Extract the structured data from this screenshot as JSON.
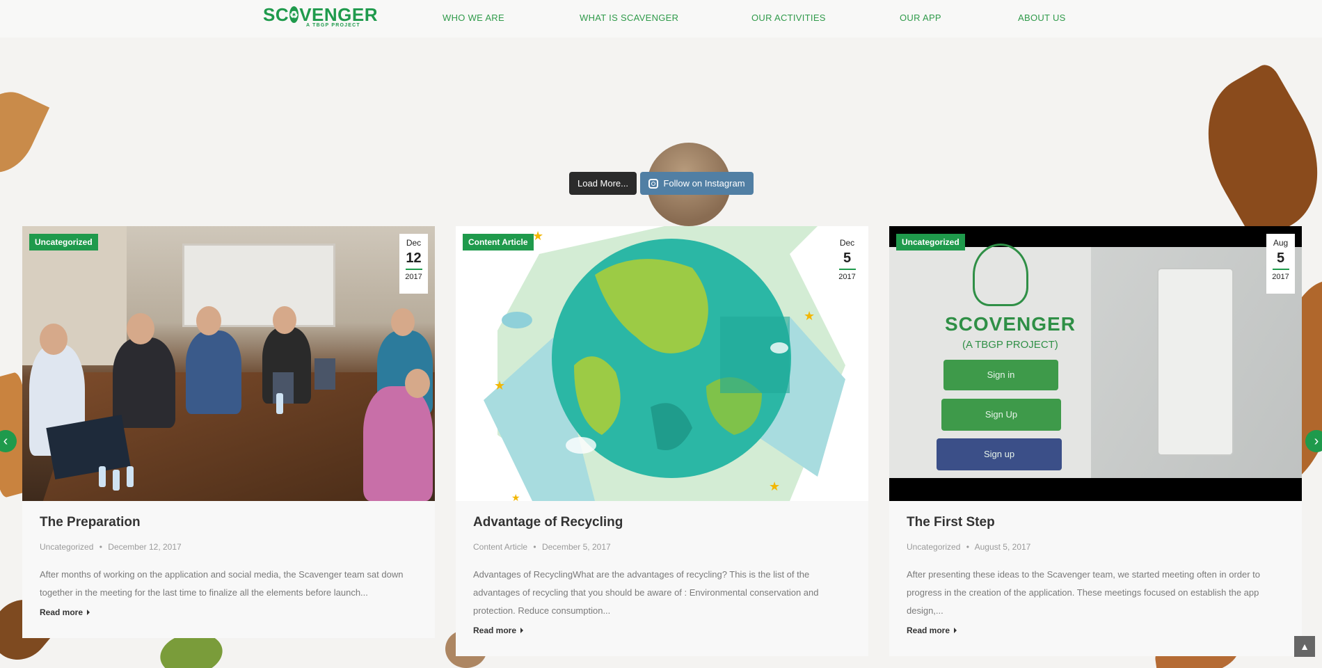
{
  "logo": {
    "main_left": "SC",
    "main_right": "VENGER",
    "sub": "A TBGP PROJECT",
    "icon": "recycle-icon"
  },
  "nav": [
    "WHO WE ARE",
    "WHAT IS SCAVENGER",
    "OUR ACTIVITIES",
    "OUR APP",
    "ABOUT US"
  ],
  "instagram": {
    "load_more": "Load More...",
    "follow": "Follow on Instagram",
    "icon": "instagram-icon"
  },
  "posts": [
    {
      "category_badge": "Uncategorized",
      "date": {
        "month": "Dec",
        "day": "12",
        "year": "2017"
      },
      "title": "The Preparation",
      "meta_category": "Uncategorized",
      "meta_date": "December 12, 2017",
      "excerpt": "After months of working on the application and social media, the Scavenger team sat down together in the meeting for the last time to finalize all the elements before launch...",
      "read_more": "Read more"
    },
    {
      "category_badge": "Content Article",
      "date": {
        "month": "Dec",
        "day": "5",
        "year": "2017"
      },
      "title": "Advantage of Recycling",
      "meta_category": "Content Article",
      "meta_date": "December 5, 2017",
      "excerpt": "Advantages of RecyclingWhat are the advantages of recycling? This is the list of the advantages of recycling that you should be aware of : Environmental conservation and protection. Reduce consumption...",
      "read_more": "Read more"
    },
    {
      "category_badge": "Uncategorized",
      "date": {
        "month": "Aug",
        "day": "5",
        "year": "2017"
      },
      "title": "The First Step",
      "meta_category": "Uncategorized",
      "meta_date": "August 5, 2017",
      "excerpt": "After presenting these ideas to the Scavenger team, we started meeting often in order to progress in the creation of the application. These meetings focused on establish the app design,...",
      "read_more": "Read more"
    }
  ],
  "app_screen": {
    "logo": "SCOVENGER",
    "sub": "(A TBGP PROJECT)",
    "signin": "Sign in",
    "signup": "Sign Up",
    "fb": "Sign up"
  },
  "colors": {
    "brand_green": "#1f9a4c",
    "nav_green": "#2f9a4a",
    "instagram_blue": "#517fa4"
  }
}
